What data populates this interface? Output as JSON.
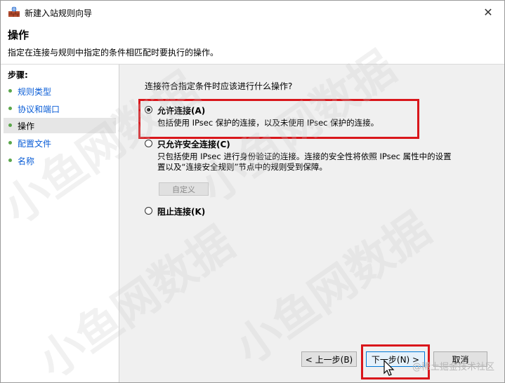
{
  "window": {
    "title": "新建入站规则向导",
    "close_glyph": "✕"
  },
  "header": {
    "title": "操作",
    "description": "指定在连接与规则中指定的条件相匹配时要执行的操作。"
  },
  "sidebar": {
    "title": "步骤:",
    "items": [
      {
        "label": "规则类型"
      },
      {
        "label": "协议和端口"
      },
      {
        "label": "操作"
      },
      {
        "label": "配置文件"
      },
      {
        "label": "名称"
      }
    ]
  },
  "main": {
    "question": "连接符合指定条件时应该进行什么操作?",
    "options": [
      {
        "label": "允许连接(A)",
        "desc": "包括使用 IPsec 保护的连接，以及未使用 IPsec 保护的连接。",
        "checked": true
      },
      {
        "label": "只允许安全连接(C)",
        "desc_line1": "只包括使用 IPsec 进行身份验证的连接。连接的安全性将依照 IPsec 属性中的设置",
        "desc_line2": "置以及“连接安全规则”节点中的规则受到保障。",
        "checked": false
      },
      {
        "label": "阻止连接(K)",
        "checked": false
      }
    ],
    "customize_button": "自定义"
  },
  "footer": {
    "back_button": "< 上一步(B)",
    "next_button": "下一步(N) >",
    "cancel_button": "取消"
  },
  "watermark": {
    "text": "小鱼网数据",
    "site": "@稀土掘金技术社区"
  },
  "colors": {
    "highlight": "#d9161b",
    "link": "#0b5ed7",
    "bullet": "#5aa64a"
  }
}
